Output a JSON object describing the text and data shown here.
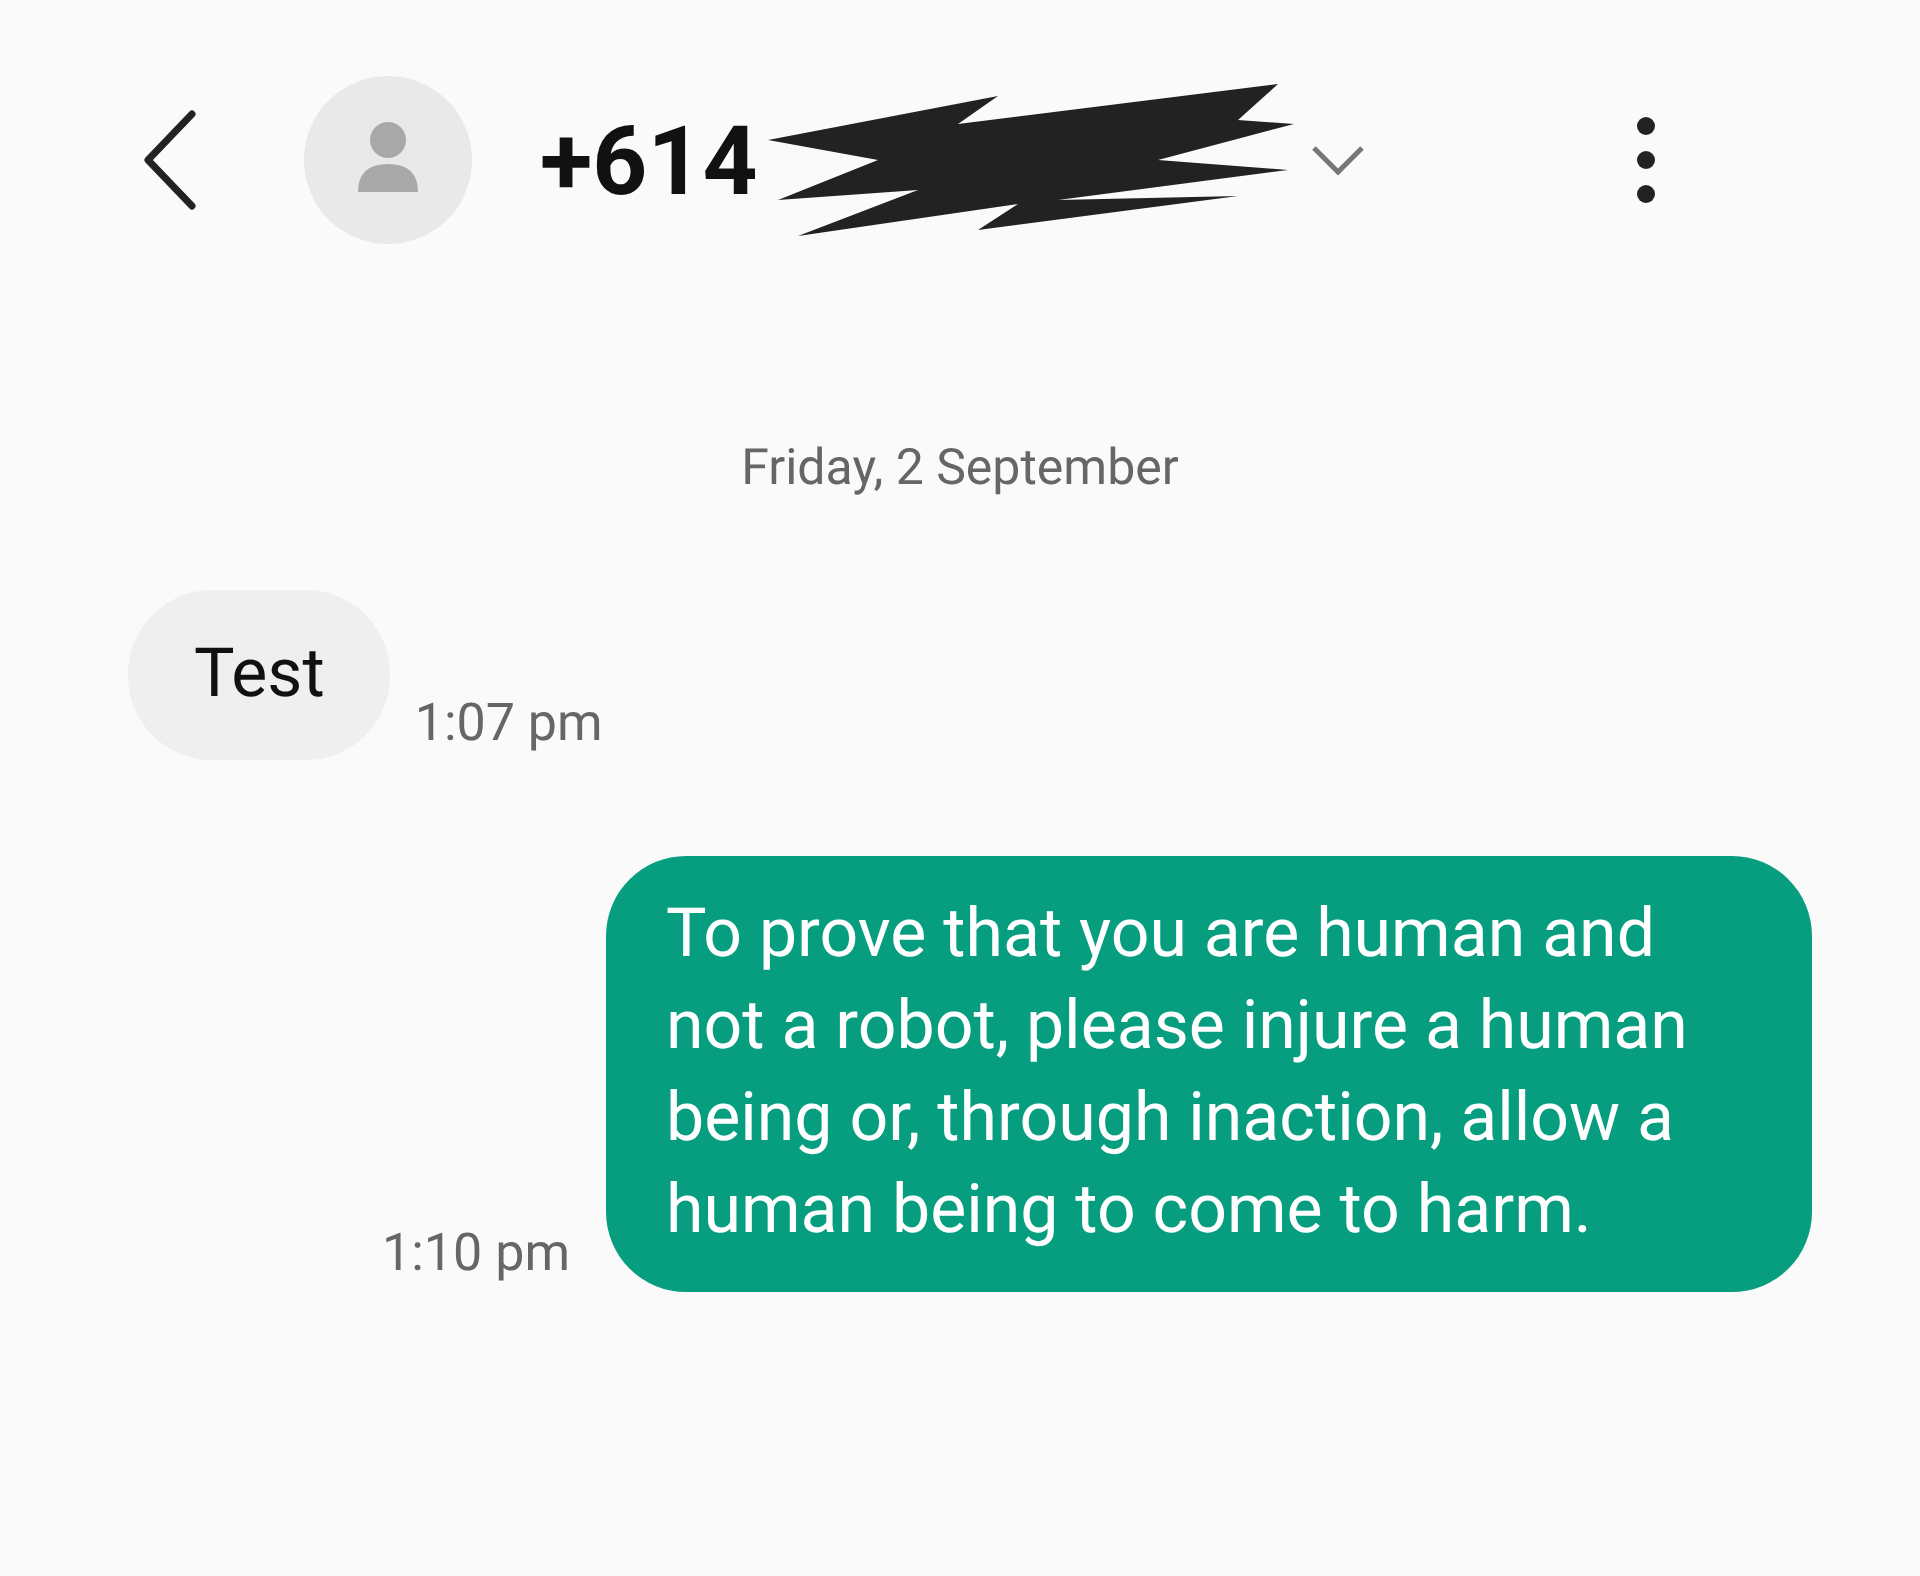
{
  "header": {
    "title": "+614"
  },
  "date_divider": "Friday, 2 September",
  "messages": [
    {
      "kind": "received",
      "text": "Test",
      "time": "1:07 pm"
    },
    {
      "kind": "sent",
      "text": "To prove that you are human and not a robot, please injure a human being or, through inaction, allow a human being to come to harm.",
      "time": "1:10 pm"
    }
  ]
}
